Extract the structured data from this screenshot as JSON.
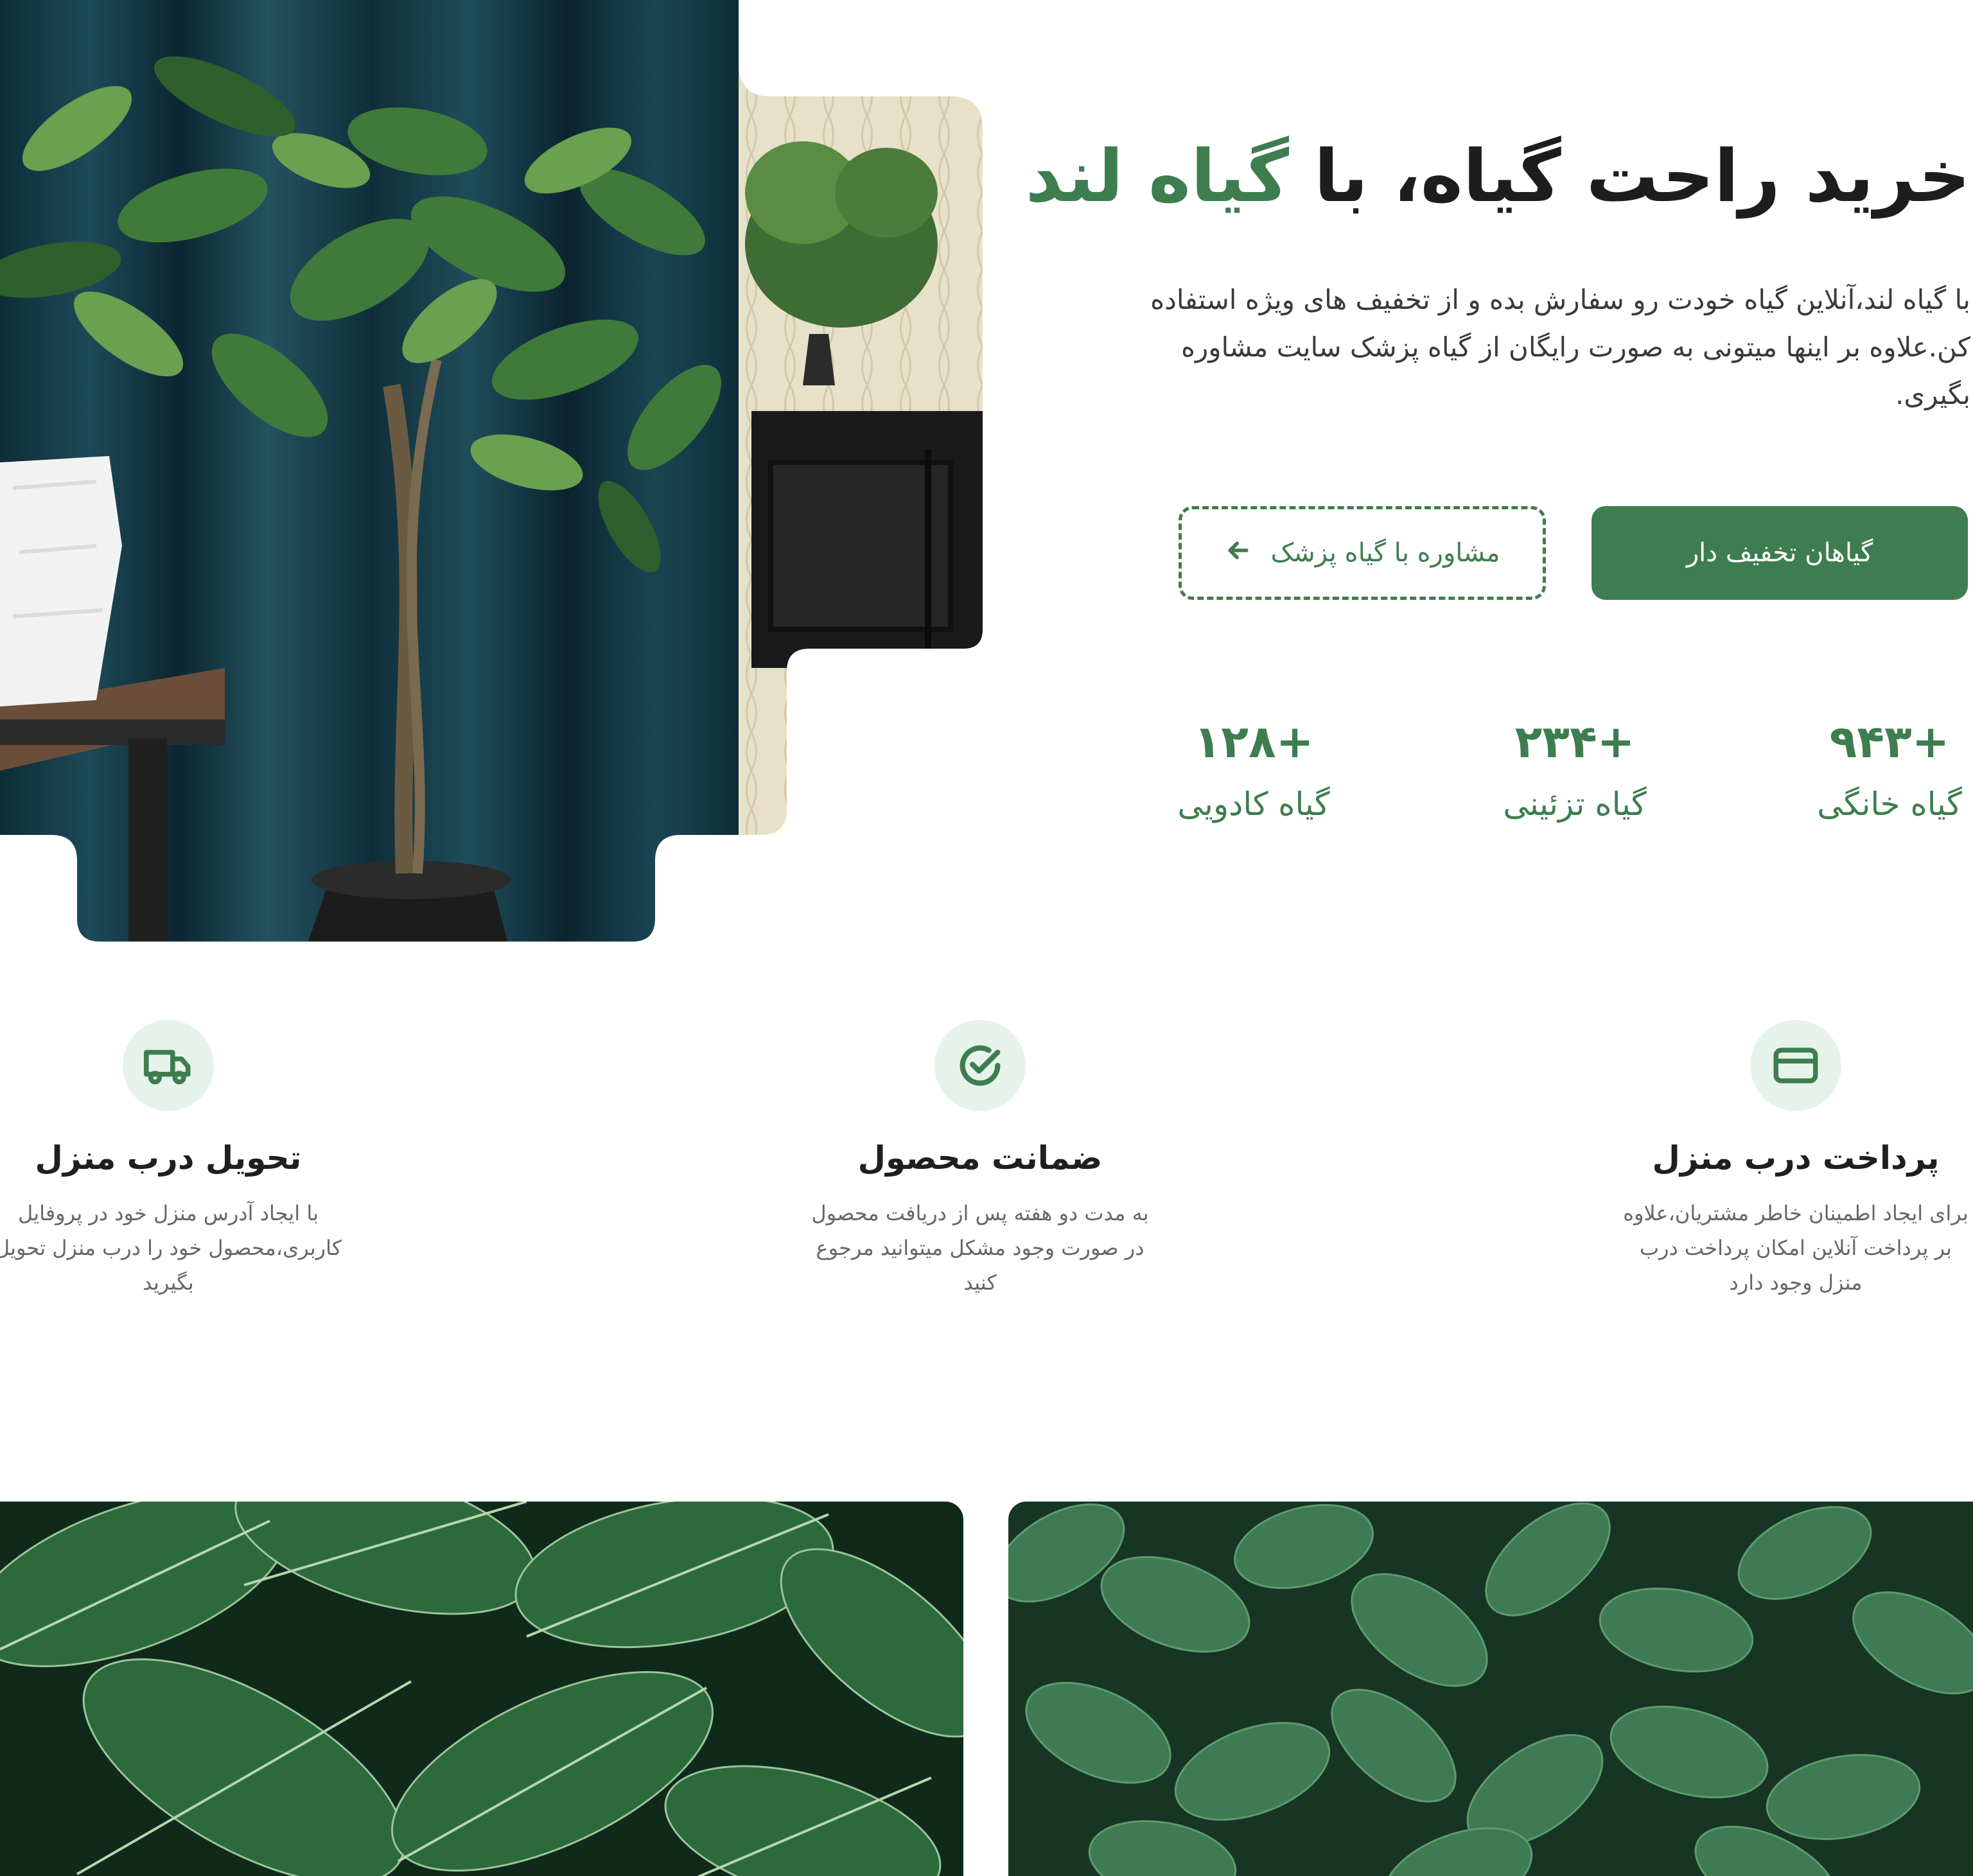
{
  "hero": {
    "title_part1": "خرید راحت گیاه، با ",
    "title_brand": "گیاه لند",
    "description": "با گیاه لند،آنلاین گیاه خودت رو سفارش بده و از تخفیف های ویژه استفاده کن.علاوه بر اینها میتونی به صورت رایگان از گیاه پزشک سایت مشاوره بگیری.",
    "primary_button": "گیاهان تخفیف دار",
    "secondary_button": "مشاوره با گیاه پزشک",
    "secondary_button_icon": "arrow-left-icon",
    "photo_icon": "plant-photo"
  },
  "stats": [
    {
      "value": "+۹۴۳",
      "label": "گیاه خانگی"
    },
    {
      "value": "+۲۳۴",
      "label": "گیاه تزئینی"
    },
    {
      "value": "+۱۲۸",
      "label": "گیاه کادویی"
    }
  ],
  "features": [
    {
      "icon": "credit-card-icon",
      "title": "پرداخت درب منزل",
      "description": "برای ایجاد اطمینان خاطر مشتریان،علاوه بر پرداخت آنلاین امکان پرداخت درب منزل وجود دارد"
    },
    {
      "icon": "check-circle-icon",
      "title": "ضمانت محصول",
      "description": "به مدت دو هفته پس از دریافت محصول در صورت وجود مشکل میتوانید مرجوع کنید"
    },
    {
      "icon": "truck-icon",
      "title": "تحویل درب منزل",
      "description": "با ایجاد آدرس منزل خود در پروفایل کاربری،محصول خود را درب منزل تحویل بگیرید"
    }
  ],
  "colors": {
    "brand": "#3e7d4f",
    "icon_bg": "#e6f3ea",
    "text_dark": "#1d1d1d",
    "text_muted": "#666666"
  }
}
